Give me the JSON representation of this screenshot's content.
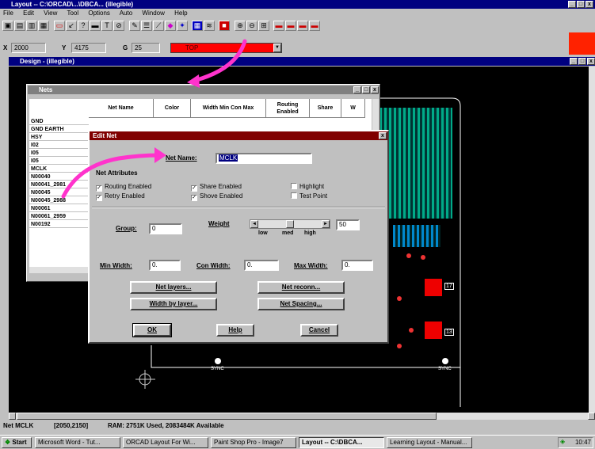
{
  "app": {
    "title": "Layout -- C:\\ORCAD\\...\\DBCA... (illegible)",
    "menu": [
      "File",
      "Edit",
      "View",
      "Tool",
      "Options",
      "Auto",
      "Window",
      "Help"
    ]
  },
  "coords": {
    "x_label": "X",
    "x_value": "2000",
    "y_label": "Y",
    "y_value": "4175",
    "g_label": "G",
    "g_value": "25",
    "layer": "TOP"
  },
  "design_window": {
    "title": "Design - (illegible)"
  },
  "nets_window": {
    "title": "Nets",
    "headers": [
      "Net Name",
      "Color",
      "Width Min Con Max",
      "Routing Enabled",
      "Share",
      "W"
    ],
    "rows": [
      "GND",
      "GND EARTH",
      "HSY",
      "I02",
      "I05",
      "I05",
      "MCLK",
      "N00040",
      "N00041_2981",
      "N00045",
      "N00045_2988",
      "N00061",
      "N00061_2959",
      "N00192"
    ]
  },
  "edit_net": {
    "title": "Edit Net",
    "net_name_label": "Net Name:",
    "net_name_value": "MCLK",
    "attributes_label": "Net Attributes",
    "checks": [
      {
        "label": "Routing Enabled",
        "checked": true
      },
      {
        "label": "Share Enabled",
        "checked": true
      },
      {
        "label": "Highlight",
        "checked": false
      },
      {
        "label": "Retry Enabled",
        "checked": true
      },
      {
        "label": "Shove Enabled",
        "checked": true
      },
      {
        "label": "Test Point",
        "checked": false
      }
    ],
    "group_label": "Group:",
    "group_value": "0",
    "weight_label": "Weight",
    "weight_value": "50",
    "weight_level": 0.5,
    "weight_ticks": [
      "low",
      "med",
      "high"
    ],
    "min_width_label": "Min Width:",
    "min_width_value": "0.",
    "con_width_label": "Con Width:",
    "con_width_value": "0.",
    "max_width_label": "Max Width:",
    "max_width_value": "0.",
    "buttons": [
      "Net layers...",
      "Net reconn...",
      "Width by layer...",
      "Net Spacing...",
      "OK",
      "Help",
      "Cancel"
    ]
  },
  "status": {
    "net": "Net MCLK",
    "coords": "[2050,2150]",
    "ram": "RAM: 2751K Used, 2083484K Available"
  },
  "pcb_labels": [
    "17",
    "13",
    "SYNC",
    "SYNC"
  ],
  "taskbar": {
    "start": "Start",
    "items": [
      "Microsoft Word - Tut...",
      "ORCAD Layout For Wi...",
      "Paint Shop Pro - Image7",
      "Layout -- C:\\DBCA...",
      "Learning Layout - Manual..."
    ],
    "clock": "10:47"
  },
  "colors": {
    "title_active": "#000080",
    "title_inactive": "#808080",
    "pcb_bg": "#000000",
    "arrow": "#ff33cc",
    "layer_red": "#ff0000"
  }
}
